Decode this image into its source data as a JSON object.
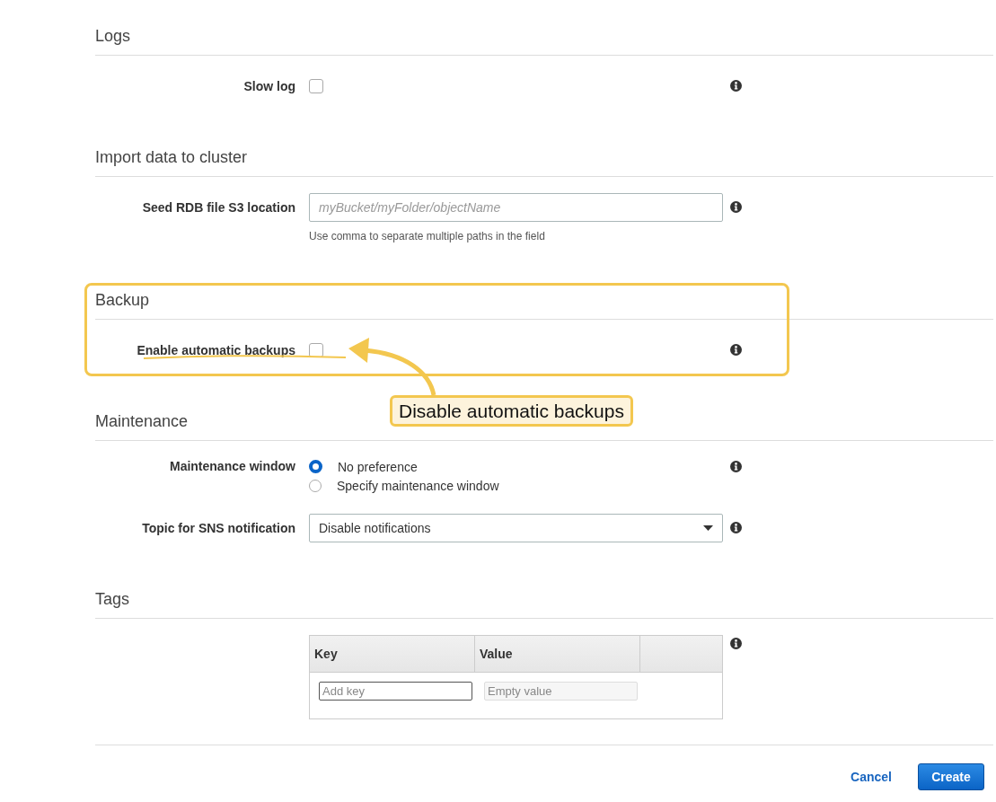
{
  "sections": [
    {
      "title": "Logs",
      "highlighted": false,
      "rows": [
        {
          "kind": "checkbox",
          "label": "Slow log",
          "checked": false
        }
      ]
    },
    {
      "title": "Import data to cluster",
      "highlighted": false,
      "rows": [
        {
          "kind": "text",
          "label": "Seed RDB file S3 location",
          "placeholder": "myBucket/myFolder/objectName",
          "hint": "Use comma to separate multiple paths in the field"
        }
      ]
    },
    {
      "title": "Backup",
      "highlighted": true,
      "rows": [
        {
          "kind": "checkbox",
          "label": "Enable automatic backups",
          "checked": false
        }
      ]
    },
    {
      "title": "Maintenance",
      "highlighted": false,
      "rows": [
        {
          "kind": "radio",
          "label": "Maintenance window",
          "options": [
            {
              "label": "No preference",
              "selected": true
            },
            {
              "label": "Specify maintenance window",
              "selected": false
            }
          ]
        },
        {
          "kind": "select",
          "label": "Topic for SNS notification",
          "value": "Disable notifications"
        }
      ]
    },
    {
      "title": "Tags",
      "highlighted": false,
      "rows": [
        {
          "kind": "tags",
          "columns": [
            "Key",
            "Value"
          ],
          "key_placeholder": "Add key",
          "value_placeholder": "Empty value"
        }
      ]
    }
  ],
  "annotation": {
    "callout": "Disable automatic backups"
  },
  "buttons": [
    {
      "label": "Cancel",
      "kind": "link"
    },
    {
      "label": "Create",
      "kind": "primary"
    }
  ]
}
